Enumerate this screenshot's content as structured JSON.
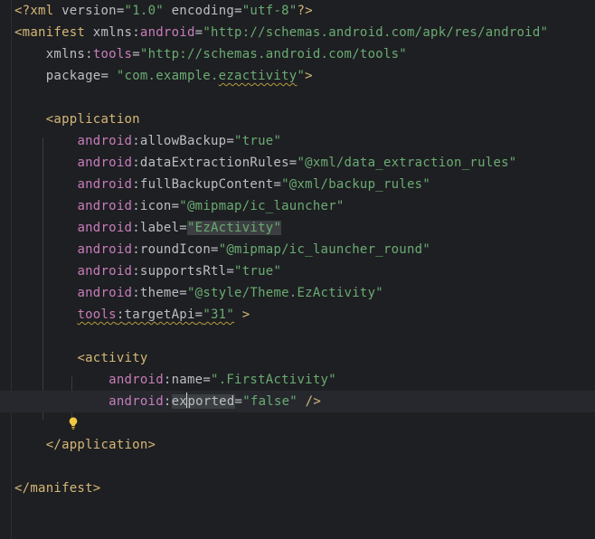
{
  "lines": {
    "l1": {
      "a": "<?xml ",
      "b": "version",
      "c": "=",
      "d": "\"1.0\"",
      "e": " ",
      "f": "encoding",
      "g": "=",
      "h": "\"utf-8\"",
      "i": "?>"
    },
    "l2": {
      "a": "<manifest ",
      "b": "xmlns",
      "c": ":",
      "d": "android",
      "e": "=",
      "f": "\"http://schemas.android.com/apk/res/android\""
    },
    "l3": {
      "a": "xmlns",
      "b": ":",
      "c": "tools",
      "d": "=",
      "e": "\"http://schemas.android.com/tools\""
    },
    "l4": {
      "a": "package",
      "b": "= ",
      "c": "\"com.example.",
      "d": "ezactivity",
      "e": "\"",
      "f": ">"
    },
    "l6": {
      "a": "<application"
    },
    "l7": {
      "a": "android",
      "b": ":",
      "c": "allowBackup",
      "d": "=",
      "e": "\"true\""
    },
    "l8": {
      "a": "android",
      "b": ":",
      "c": "dataExtractionRules",
      "d": "=",
      "e": "\"@xml/data_extraction_rules\""
    },
    "l9": {
      "a": "android",
      "b": ":",
      "c": "fullBackupContent",
      "d": "=",
      "e": "\"@xml/backup_rules\""
    },
    "l10": {
      "a": "android",
      "b": ":",
      "c": "icon",
      "d": "=",
      "e": "\"@mipmap/ic_launcher\""
    },
    "l11": {
      "a": "android",
      "b": ":",
      "c": "label",
      "d": "=",
      "e": "\"EzActivity\""
    },
    "l12": {
      "a": "android",
      "b": ":",
      "c": "roundIcon",
      "d": "=",
      "e": "\"@mipmap/ic_launcher_round\""
    },
    "l13": {
      "a": "android",
      "b": ":",
      "c": "supportsRtl",
      "d": "=",
      "e": "\"true\""
    },
    "l14": {
      "a": "android",
      "b": ":",
      "c": "theme",
      "d": "=",
      "e": "\"@style/Theme.EzActivity\""
    },
    "l15": {
      "a": "tools",
      "b": ":",
      "c": "targetApi",
      "d": "=",
      "e": "\"31\"",
      "f": " >"
    },
    "l17": {
      "a": "<activity"
    },
    "l18": {
      "a": "android",
      "b": ":",
      "c": "name",
      "d": "=",
      "e": "\".FirstActivity\""
    },
    "l19": {
      "a": "android",
      "b": ":",
      "c1": "ex",
      "c2": "ported",
      "d": "=",
      "e": "\"false\"",
      "f": " />"
    },
    "l21": {
      "a": "</application>"
    },
    "l23": {
      "a": "</manifest>"
    }
  },
  "icons": {
    "intention_bulb": "lightbulb-icon"
  },
  "colors": {
    "background": "#1e1f22",
    "current_line": "#26282e",
    "tag": "#d5b778",
    "namespace": "#c77dbb",
    "attribute": "#bcbec4",
    "string": "#6aab73",
    "warning_squiggle": "#b59a3c",
    "bulb": "#f0c940"
  }
}
